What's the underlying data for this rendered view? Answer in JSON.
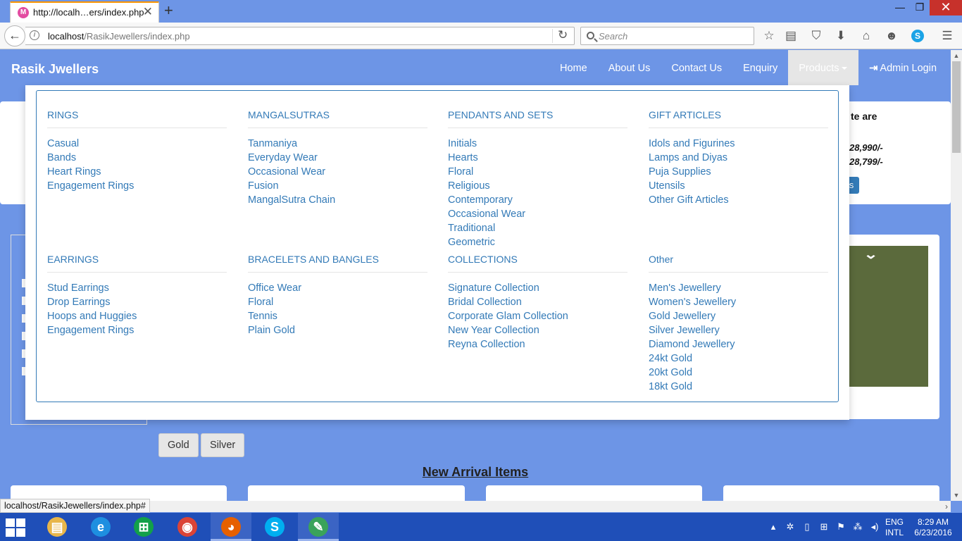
{
  "browser": {
    "tab_title": "http://localh…ers/index.php",
    "favicon_letter": "M",
    "url_host": "localhost",
    "url_path": "/RasikJewellers/index.php",
    "search_placeholder": "Search",
    "status_url": "localhost/RasikJewellers/index.php#"
  },
  "site": {
    "brand": "Rasik Jwellers",
    "nav": [
      {
        "label": "Home"
      },
      {
        "label": "About Us"
      },
      {
        "label": "Contact Us"
      },
      {
        "label": "Enquiry"
      },
      {
        "label": "Products"
      },
      {
        "label": "Admin Login"
      }
    ]
  },
  "background": {
    "panel_text": "te are",
    "price_1": "28,990/-",
    "price_2": "28,799/-",
    "button_fragment": "s",
    "filters": [
      "Gold",
      "Silver"
    ],
    "new_arrival_heading": "New Arrival Items"
  },
  "mega_menu": {
    "columns": [
      {
        "title": "RINGS",
        "links": [
          "Casual",
          "Bands",
          "Heart Rings",
          "Engagement Rings"
        ]
      },
      {
        "title": "MANGALSUTRAS",
        "links": [
          "Tanmaniya",
          "Everyday Wear",
          "Occasional Wear",
          "Fusion",
          "MangalSutra Chain"
        ]
      },
      {
        "title": "PENDANTS AND SETS",
        "links": [
          "Initials",
          "Hearts",
          "Floral",
          "Religious",
          "Contemporary",
          "Occasional Wear",
          "Traditional",
          "Geometric"
        ]
      },
      {
        "title": "GIFT ARTICLES",
        "links": [
          "Idols and Figurines",
          "Lamps and Diyas",
          "Puja Supplies",
          "Utensils",
          "Other Gift Articles"
        ]
      },
      {
        "title": "EARRINGS",
        "links": [
          "Stud Earrings",
          "Drop Earrings",
          "Hoops and Huggies",
          "Engagement Rings"
        ]
      },
      {
        "title": "BRACELETS AND BANGLES",
        "links": [
          "Office Wear",
          "Floral",
          "Tennis",
          "Plain Gold"
        ]
      },
      {
        "title": "COLLECTIONS",
        "links": [
          "Signature Collection",
          "Bridal Collection",
          "Corporate Glam Collection",
          "New Year Collection",
          "Reyna Collection"
        ]
      },
      {
        "title": "Other",
        "links": [
          "Men's Jewellery",
          "Women's Jewellery",
          "Gold Jewellery",
          "Silver Jewellery",
          "Diamond Jewellery",
          "24kt Gold",
          "20kt Gold",
          "18kt Gold"
        ]
      }
    ]
  },
  "taskbar": {
    "apps": [
      {
        "icon": "file-explorer-icon",
        "glyph": "▤",
        "color": "#e8b64a"
      },
      {
        "icon": "internet-explorer-icon",
        "glyph": "e",
        "color": "#1e8fe0"
      },
      {
        "icon": "store-icon",
        "glyph": "⊞",
        "color": "#12a04a"
      },
      {
        "icon": "chrome-icon",
        "glyph": "◉",
        "color": "#db4437"
      },
      {
        "icon": "firefox-icon",
        "glyph": "◕",
        "color": "#e66000"
      },
      {
        "icon": "skype-icon",
        "glyph": "S",
        "color": "#00aff0"
      },
      {
        "icon": "notepad-icon",
        "glyph": "✎",
        "color": "#3aa35a"
      }
    ],
    "lang_1": "ENG",
    "lang_2": "INTL",
    "time": "8:29 AM",
    "date": "6/23/2016"
  }
}
